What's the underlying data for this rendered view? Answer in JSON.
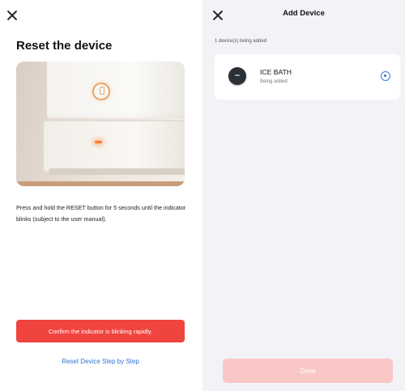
{
  "left_screen": {
    "title": "Reset the device",
    "instruction": "Press and hold the RESET button for 5 seconds until the indicator blinks (subject to the user manual).",
    "confirm_button": "Confirm the indicator is blinking rapidly.",
    "step_link": "Reset Device Step by Step",
    "icons": {
      "close": "close-icon",
      "power": "power-icon"
    },
    "colors": {
      "confirm": "#f0443f",
      "link": "#2f73d6",
      "indicator": "#ff7a2a"
    }
  },
  "right_screen": {
    "title": "Add Device",
    "adding_count": "1 device(s) being added",
    "devices": [
      {
        "name": "ICE BATH",
        "status": "Being added"
      }
    ],
    "done_button": "Done",
    "icons": {
      "close": "close-icon",
      "device": "ice-bath-device-icon",
      "progress": "progress-spinner-icon"
    },
    "colors": {
      "background": "#f3f3f7",
      "done_disabled": "#f9c7c6",
      "progress": "#3a7fe0"
    }
  }
}
